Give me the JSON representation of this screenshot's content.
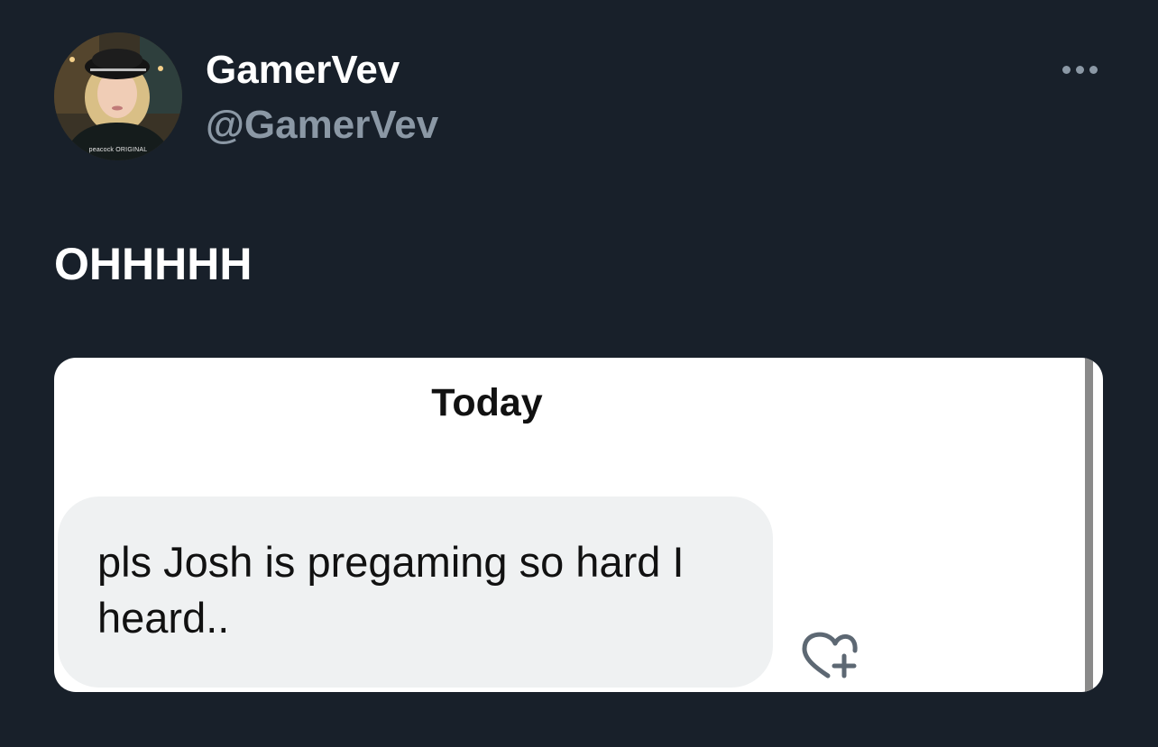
{
  "tweet": {
    "display_name": "GamerVev",
    "handle": "@GamerVev",
    "avatar_watermark": "peacock ORIGINAL",
    "text": "OHHHHH",
    "more_icon": "more-horizontal-icon"
  },
  "media": {
    "date_label": "Today",
    "message_text": "pls Josh is pregaming so hard I heard..",
    "react_icon": "heart-plus-icon"
  },
  "colors": {
    "background": "#18202a",
    "primary_text": "#ffffff",
    "secondary_text": "#8b98a5",
    "bubble": "#eff1f2"
  }
}
